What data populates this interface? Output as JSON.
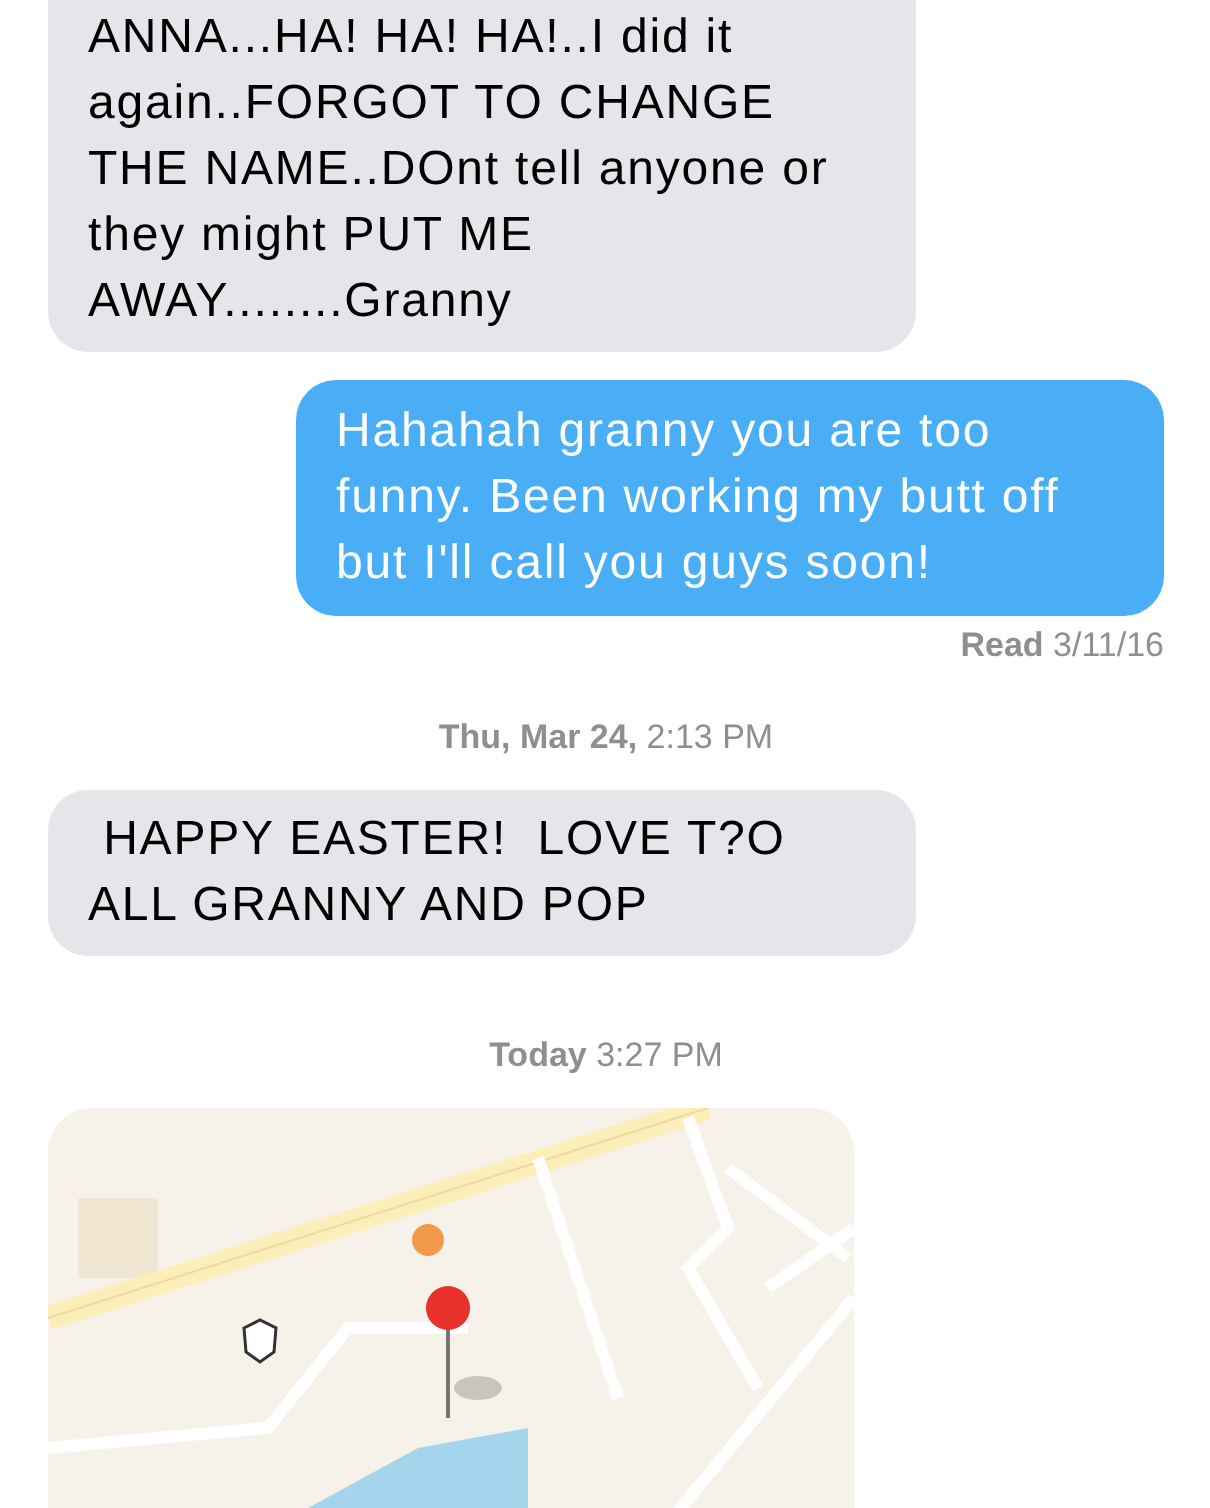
{
  "thread": [
    {
      "kind": "received",
      "text": "ANNA...HA! HA! HA!..I did it again..FORGOT TO CHANGE THE NAME..DOnt tell anyone or they might PUT ME AWAY........Granny",
      "cut_top": true
    },
    {
      "kind": "sent",
      "text": "Hahahah granny you are too funny. Been working my butt off but I'll call you guys soon!"
    },
    {
      "kind": "receipt",
      "text": "**Read** 3/11/16"
    },
    {
      "kind": "timestamp",
      "text": "**Thu, Mar 24,** 2:13 PM"
    },
    {
      "kind": "received",
      "text": " HAPPY EASTER!  LOVE T?O ALL GRANNY AND POP"
    },
    {
      "kind": "timestamp",
      "text": "**Today** 3:27 PM"
    },
    {
      "kind": "map"
    }
  ]
}
